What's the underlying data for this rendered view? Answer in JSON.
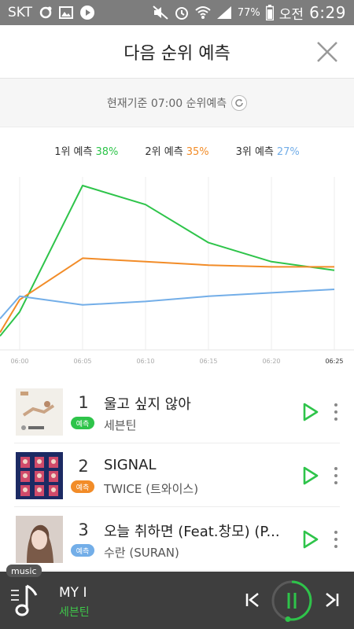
{
  "status_bar": {
    "carrier": "SKT",
    "battery": "77%",
    "clock_prefix": "오전",
    "time": "6:29",
    "icons": [
      "notification-icon",
      "image-icon",
      "play-store-icon",
      "mute-icon",
      "alarm-icon",
      "wifi-icon",
      "signal-icon",
      "battery-icon"
    ]
  },
  "header": {
    "title": "다음 순위 예측",
    "close_icon": "close-icon"
  },
  "basis": {
    "text": "현재기준 07:00 순위예측",
    "refresh_icon": "refresh-icon"
  },
  "legend": [
    {
      "label": "1위 예측",
      "pct": "38%",
      "color": "#2ec44a"
    },
    {
      "label": "2위 예측",
      "pct": "35%",
      "color": "#f28c28"
    },
    {
      "label": "3위 예측",
      "pct": "27%",
      "color": "#73aee8"
    }
  ],
  "chart_data": {
    "type": "line",
    "x": [
      "06:00",
      "06:05",
      "06:10",
      "06:15",
      "06:20",
      "06:25"
    ],
    "x_highlight": "06:25",
    "ylim": [
      0,
      100
    ],
    "series": [
      {
        "rank": 1,
        "color": "#2ec44a",
        "start": 8,
        "values": [
          22,
          95,
          84,
          62,
          51,
          46
        ]
      },
      {
        "rank": 2,
        "color": "#f28c28",
        "start": 10,
        "values": [
          29,
          53,
          51,
          49,
          48,
          48
        ]
      },
      {
        "rank": 3,
        "color": "#73aee8",
        "start": 18,
        "values": [
          31,
          26,
          28,
          31,
          33,
          35
        ]
      }
    ]
  },
  "songs": [
    {
      "rank": "1",
      "badge": "예측",
      "badge_color": "#2ec44a",
      "title": "울고 싶지 않아",
      "artist": "세븐틴"
    },
    {
      "rank": "2",
      "badge": "예측",
      "badge_color": "#f28c28",
      "title": "SIGNAL",
      "artist": "TWICE (트와이스)"
    },
    {
      "rank": "3",
      "badge": "예측",
      "badge_color": "#73aee8",
      "title": "오늘 취하면 (Feat.창모) (P...",
      "artist": "수란 (SURAN)"
    }
  ],
  "player": {
    "tab_label": "music",
    "title": "MY I",
    "artist": "세븐틴"
  },
  "colors": {
    "accent": "#2ec44a",
    "player_bg": "#3e3e3e"
  }
}
